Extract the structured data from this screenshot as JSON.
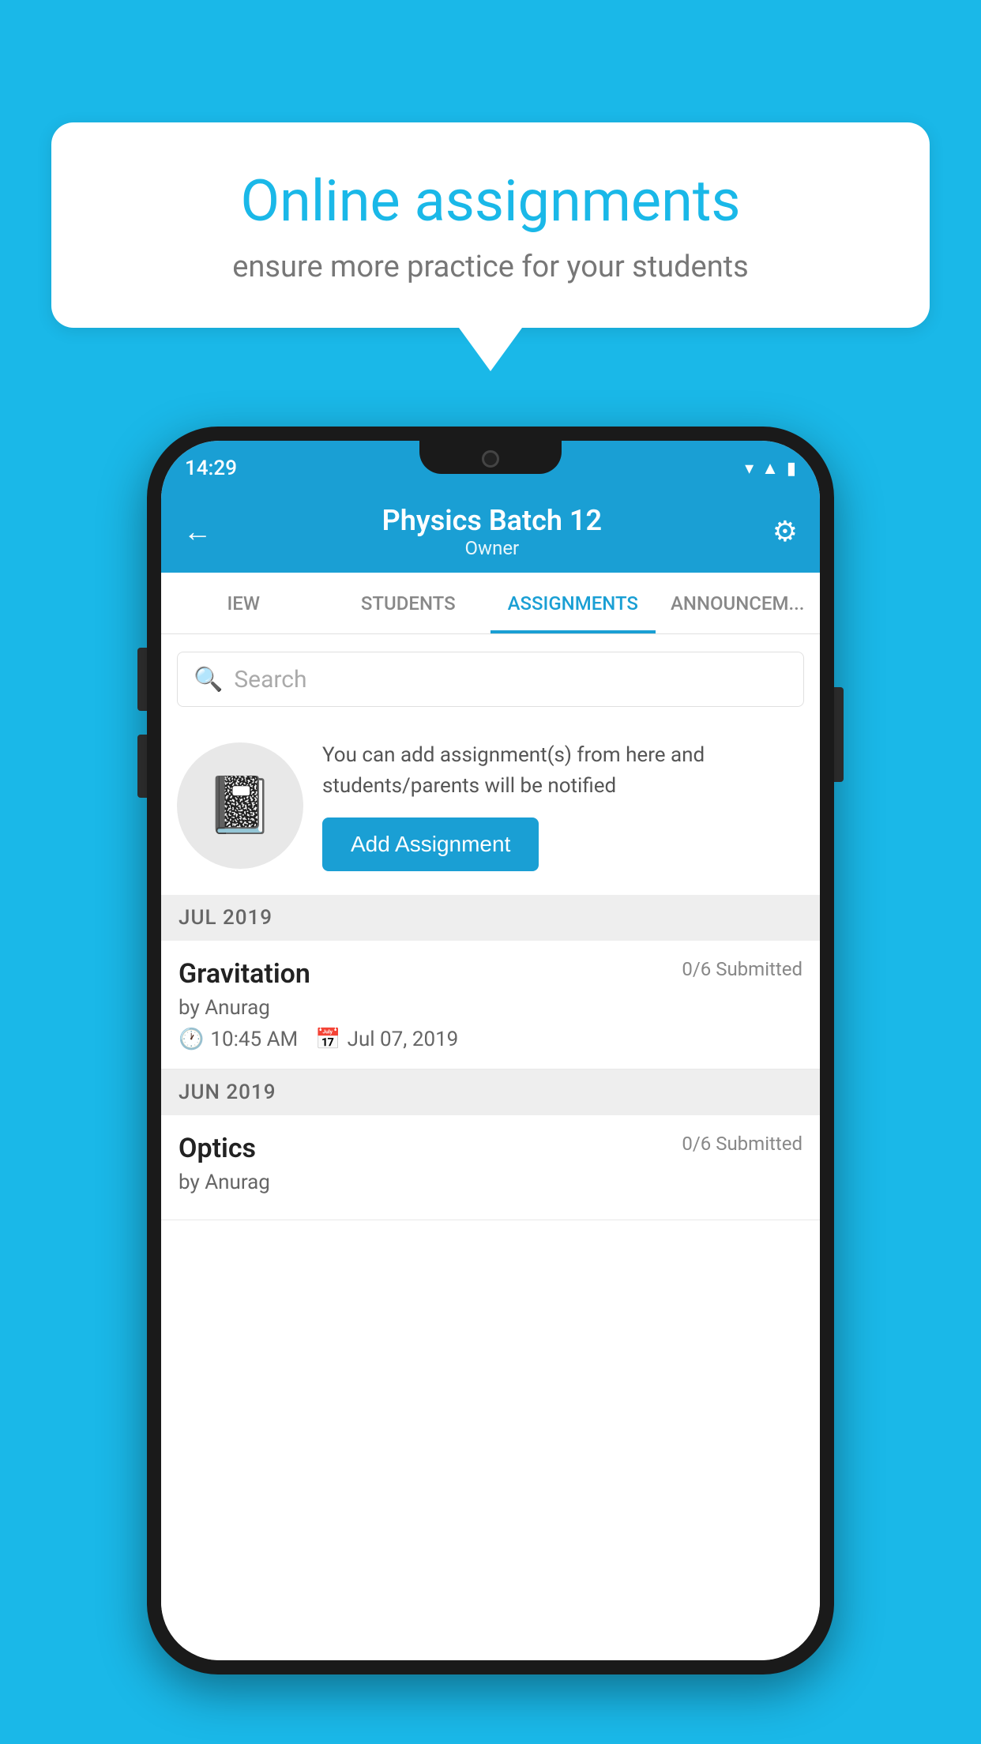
{
  "background_color": "#1ab8e8",
  "speech_bubble": {
    "title": "Online assignments",
    "subtitle": "ensure more practice for your students"
  },
  "status_bar": {
    "time": "14:29",
    "icons": [
      "wifi",
      "signal",
      "battery"
    ]
  },
  "header": {
    "title": "Physics Batch 12",
    "subtitle": "Owner",
    "back_label": "←",
    "settings_label": "⚙"
  },
  "tabs": [
    {
      "label": "IEW",
      "active": false
    },
    {
      "label": "STUDENTS",
      "active": false
    },
    {
      "label": "ASSIGNMENTS",
      "active": true
    },
    {
      "label": "ANNOUNCEM...",
      "active": false
    }
  ],
  "search": {
    "placeholder": "Search"
  },
  "info_section": {
    "icon": "📓",
    "description": "You can add assignment(s) from here and students/parents will be notified",
    "add_button_label": "Add Assignment"
  },
  "months": [
    {
      "label": "JUL 2019",
      "assignments": [
        {
          "title": "Gravitation",
          "submitted": "0/6 Submitted",
          "author": "by Anurag",
          "time": "10:45 AM",
          "date": "Jul 07, 2019"
        }
      ]
    },
    {
      "label": "JUN 2019",
      "assignments": [
        {
          "title": "Optics",
          "submitted": "0/6 Submitted",
          "author": "by Anurag",
          "time": "",
          "date": ""
        }
      ]
    }
  ]
}
